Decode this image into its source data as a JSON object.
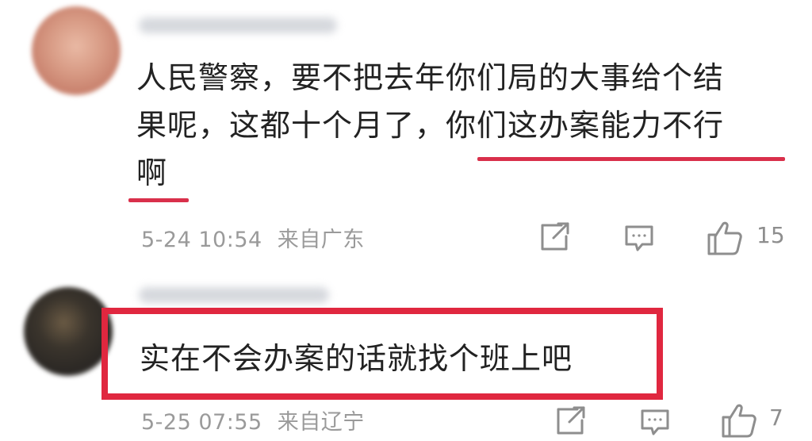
{
  "comments": [
    {
      "text_lines": [
        "人民警察，要不把去年你们局的大事给个结",
        "果呢，这都十个月了，你们这办案能力不行",
        "啊"
      ],
      "timestamp": "5-24 10:54",
      "location": "来自广东",
      "likes": "15"
    },
    {
      "text": "实在不会办案的话就找个班上吧",
      "timestamp": "5-25 07:55",
      "location": "来自辽宁",
      "likes": "7"
    }
  ],
  "icons": {
    "share": "share-icon",
    "reply": "comment-icon",
    "like": "thumbs-up-icon"
  },
  "colors": {
    "highlight": "#e0273f",
    "meta_text": "#9a9a9a"
  }
}
